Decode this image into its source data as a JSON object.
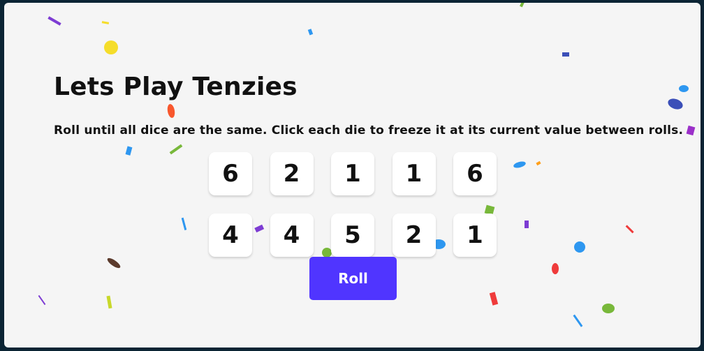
{
  "game": {
    "title": "Lets Play Tenzies",
    "instructions": "Roll until all dice are the same. Click each die to freeze it at its current value between rolls."
  },
  "dice": [
    {
      "value": 6
    },
    {
      "value": 2
    },
    {
      "value": 1
    },
    {
      "value": 1
    },
    {
      "value": 6
    },
    {
      "value": 4
    },
    {
      "value": 4
    },
    {
      "value": 5
    },
    {
      "value": 2
    },
    {
      "value": 1
    }
  ],
  "roll_button": {
    "label": "Roll"
  },
  "colors": {
    "page_background": "#0b2434",
    "board_background": "#f5f5f5",
    "die_background": "#ffffff",
    "button_background": "#5035ff",
    "button_text": "#ffffff",
    "confetti": [
      "#f5dd2a",
      "#f8572d",
      "#7d3cd3",
      "#2e97f0",
      "#78b83a",
      "#5b3a2c",
      "#3b4fb8",
      "#ff9f1a",
      "#9b30c9",
      "#ef3b3b"
    ]
  }
}
